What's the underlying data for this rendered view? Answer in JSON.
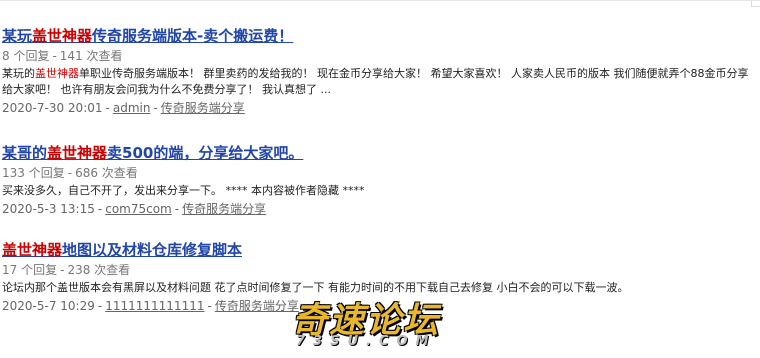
{
  "results": [
    {
      "title_pre": "某玩",
      "title_hl": "盖世神器",
      "title_post": "传奇服务端版本-卖个搬运费！",
      "replies": "8 个回复",
      "views": "141 次查看",
      "snippet_pre": "某玩的",
      "snippet_hl": "盖世神器",
      "snippet_post": "单职业传奇服务端版本！ 群里卖药的发给我的！ 现在金币分享给大家！ 希望大家喜欢！ 人家卖人民币的版本 我们随便就弄个88金币分享给大家吧！ 也许有朋友会问我为什么不免费分享了！ 我认真想了 ...",
      "date": "2020-7-30 20:01",
      "author": "admin",
      "forum": "传奇服务端分享"
    },
    {
      "title_pre": "某哥的",
      "title_hl": "盖世神器",
      "title_post": "卖500的端，分享给大家吧。",
      "replies": "133 个回复",
      "views": "686 次查看",
      "snippet": "买来没多久，自己不开了，发出来分享一下。 **** 本内容被作者隐藏 ****",
      "date": "2020-5-3 13:15",
      "author": "com75com",
      "forum": "传奇服务端分享"
    },
    {
      "title_pre": "",
      "title_hl": "盖世神器",
      "title_post": "地图以及材料仓库修复脚本",
      "replies": "17 个回复",
      "views": "238 次查看",
      "snippet": "论坛内那个盖世版本会有黑屏以及材料问题 花了点时间修复了一下 有能力时间的不用下载自己去修复 小白不会的可以下载一波。",
      "date": "2020-5-7 10:29",
      "author": "1111111111111",
      "forum": "传奇服务端分享"
    }
  ],
  "separator": "-",
  "watermark": {
    "main": "奇速论坛",
    "sub": "73SU.COM",
    "color": "#e8b72c"
  }
}
